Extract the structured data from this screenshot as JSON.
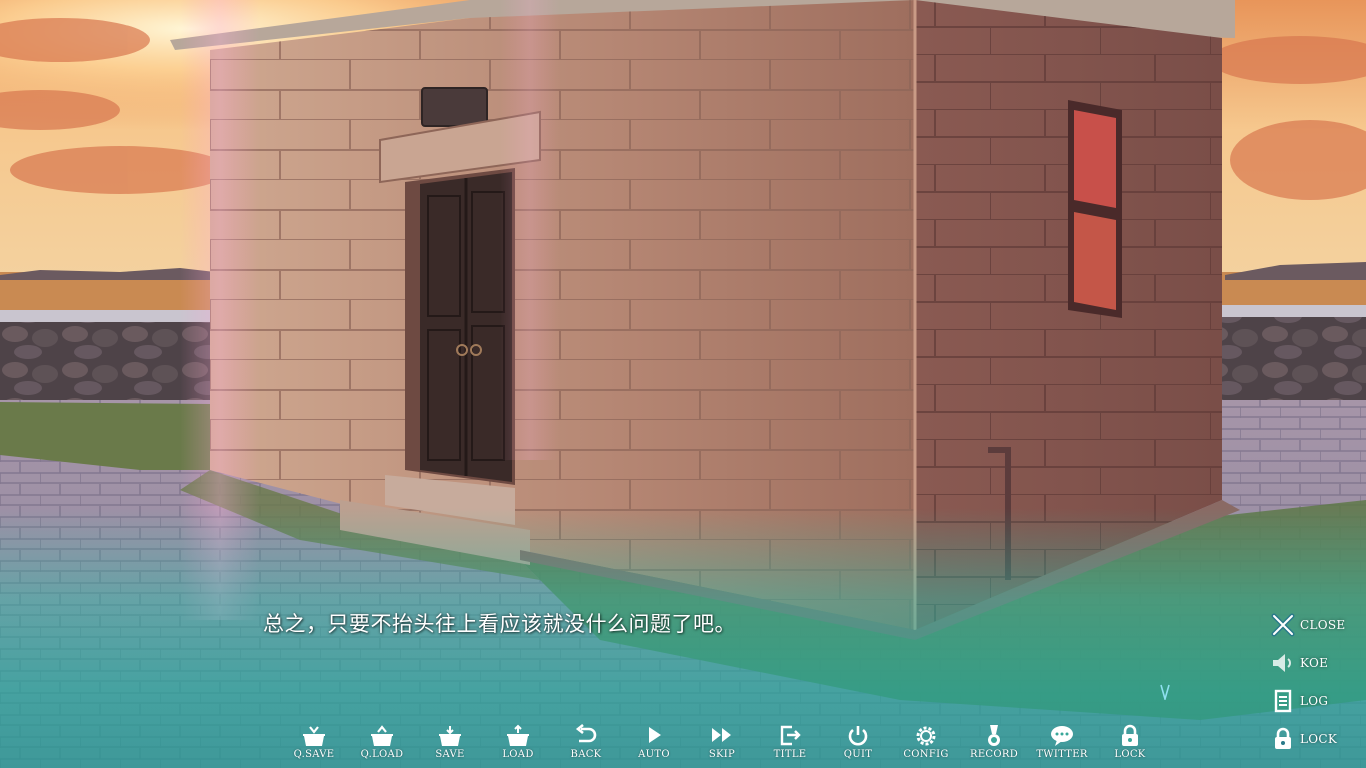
{
  "dialog": {
    "text": "总之，只要不抬头往上看应该就没什么问题了吧。",
    "next_indicator": "chevron-down-icon"
  },
  "toolbar": [
    {
      "id": "qsave",
      "label": "Q.SAVE",
      "icon": "quick-save-icon"
    },
    {
      "id": "qload",
      "label": "Q.LOAD",
      "icon": "quick-load-icon"
    },
    {
      "id": "save",
      "label": "SAVE",
      "icon": "save-icon"
    },
    {
      "id": "load",
      "label": "LOAD",
      "icon": "load-icon"
    },
    {
      "id": "back",
      "label": "BACK",
      "icon": "back-arrow-icon"
    },
    {
      "id": "auto",
      "label": "AUTO",
      "icon": "play-icon"
    },
    {
      "id": "skip",
      "label": "SKIP",
      "icon": "fast-forward-icon"
    },
    {
      "id": "title",
      "label": "TITLE",
      "icon": "exit-door-icon"
    },
    {
      "id": "quit",
      "label": "QUIT",
      "icon": "power-icon"
    },
    {
      "id": "config",
      "label": "CONFIG",
      "icon": "gear-icon"
    },
    {
      "id": "record",
      "label": "RECORD",
      "icon": "medal-icon"
    },
    {
      "id": "twitter",
      "label": "TWITTER",
      "icon": "speech-bubble-icon"
    },
    {
      "id": "lock",
      "label": "LOCK",
      "icon": "lock-icon"
    }
  ],
  "side_menu": [
    {
      "id": "close",
      "label": "CLOSE",
      "icon": "close-icon"
    },
    {
      "id": "koe",
      "label": "KOE",
      "icon": "speaker-icon"
    },
    {
      "id": "log",
      "label": "LOG",
      "icon": "log-icon"
    },
    {
      "id": "lock",
      "label": "LOCK",
      "icon": "lock-icon"
    }
  ],
  "colors": {
    "ui_text": "#ffffff",
    "dialog_overlay": "#2fb3a0",
    "sky_sunset": "#f2b06a"
  }
}
